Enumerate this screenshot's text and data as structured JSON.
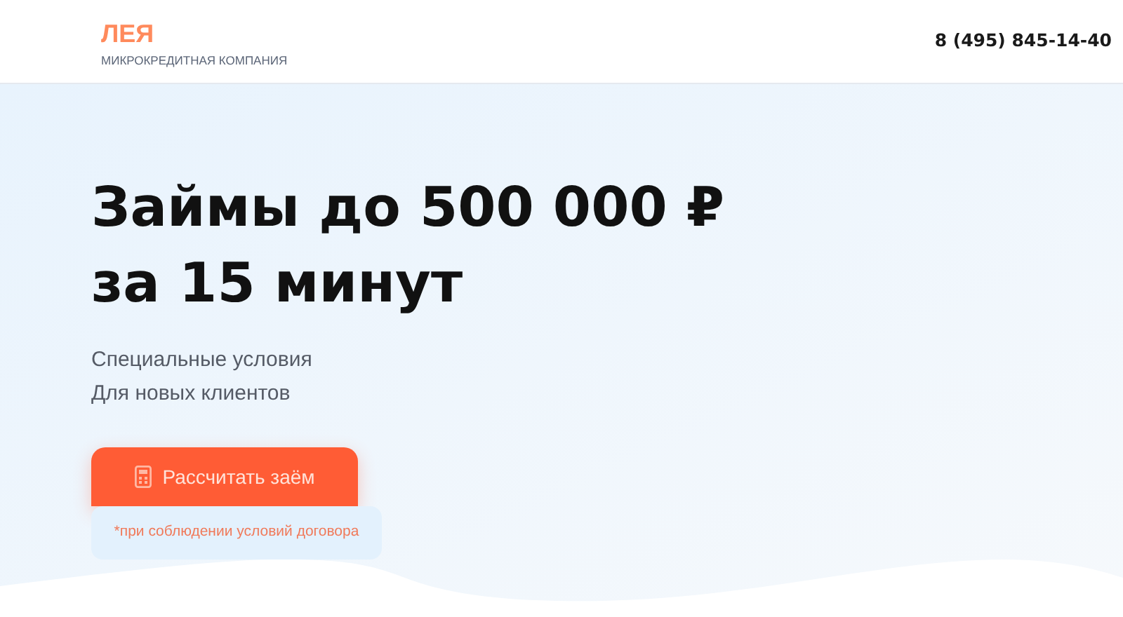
{
  "header": {
    "logo": "ЛЕЯ",
    "tagline": "МИКРОКРЕДИТНАЯ КОМПАНИЯ",
    "phone": "8 (495) 845-14-40"
  },
  "hero": {
    "title_lines": [
      "Займы до 500 000 ₽",
      "за 15 минут"
    ],
    "subtitle_lines": [
      "Специальные условия",
      "Для новых клиентов"
    ],
    "button": "Рассчитать заём",
    "note": "*при соблюдении условий договора"
  }
}
